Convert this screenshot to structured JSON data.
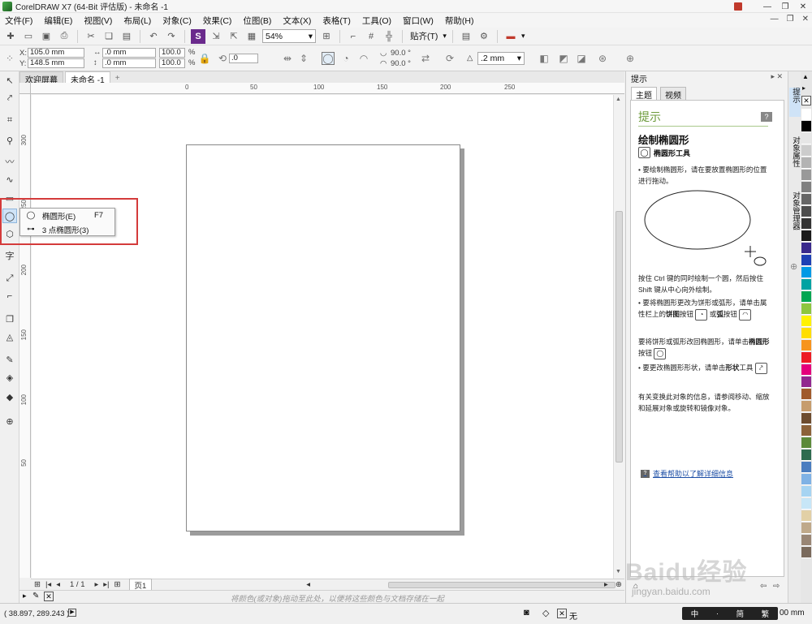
{
  "window": {
    "title": "CorelDRAW X7 (64-Bit 评估版) - 未命名 -1"
  },
  "menu": [
    "文件(F)",
    "编辑(E)",
    "视图(V)",
    "布局(L)",
    "对象(C)",
    "效果(C)",
    "位图(B)",
    "文本(X)",
    "表格(T)",
    "工具(O)",
    "窗口(W)",
    "帮助(H)"
  ],
  "toolbar": {
    "zoom": "54%",
    "snap_label": "贴齐(T)"
  },
  "property_bar": {
    "x": "105.0 mm",
    "y": "148.5 mm",
    "width": ".0 mm",
    "height": ".0 mm",
    "scale_x": "100.0",
    "scale_y": "100.0",
    "percent": "%",
    "rotation": ".0",
    "start_angle": "90.0 °",
    "end_angle": "90.0 °",
    "outline": ".2 mm",
    "label_x": "X:",
    "label_y": "Y:"
  },
  "doc_tabs": [
    "欢迎屏幕",
    "未命名 -1"
  ],
  "hruler": [
    "0",
    "50",
    "100",
    "150",
    "200",
    "250"
  ],
  "vruler": [
    "300",
    "250",
    "200",
    "150",
    "100",
    "50"
  ],
  "flyout": {
    "items": [
      {
        "label": "椭圆形(E)",
        "shortcut": "F7",
        "icon": "ellipse-icon"
      },
      {
        "label": "3 点椭圆形(3)",
        "shortcut": "",
        "icon": "three-point-ellipse-icon"
      }
    ]
  },
  "page_nav": {
    "counter": "1 / 1",
    "page_tab": "页1"
  },
  "color_hint": "将颜色(或对象)拖动至此处，以便将这些颜色与文档存储在一起",
  "status": {
    "coords": "( 38.897, 289.243 )",
    "fill_none": "无",
    "size": "00 mm"
  },
  "docker": {
    "title": "提示",
    "tabs": [
      "主题",
      "视频"
    ],
    "section_title": "提示",
    "heading": "绘制椭圆形",
    "tool_name": "椭圆形工具",
    "para1": "• 要绘制椭圆形，请在要放置椭圆形的位置进行拖动。",
    "para2": "按住 Ctrl 键的同时绘制一个圆，然后按住 Shift 键从中心向外绘制。",
    "para3a": "• 要将椭圆形更改为饼形或弧形，请单击属性栏上的",
    "para3_pie": "饼图",
    "para3b": "按钮",
    "para3c": "或",
    "para3_arc": "弧",
    "para3d": "按钮",
    "para4a": "要将饼形或弧形改回椭圆形，请单击",
    "para4_ellipse": "椭圆形",
    "para4b": "按钮",
    "para5a": "• 要更改椭圆形形状，请单击",
    "para5_shape": "形状",
    "para5b": "工具",
    "para6": "有关变换此对象的信息，请参阅移动、缩放和延展对象或旋转和镜像对象。",
    "more_link": "查看帮助以了解详细信息"
  },
  "side_tabs": [
    "提示",
    "对象属性",
    "对象管理器"
  ],
  "palette_colors": [
    "#ffffff",
    "#000000",
    "#e6e6e6",
    "#cccccc",
    "#b3b3b3",
    "#999999",
    "#808080",
    "#666666",
    "#4d4d4d",
    "#333333",
    "#1a1a1a",
    "#3a2a8c",
    "#1e40b4",
    "#0099e5",
    "#00a3a3",
    "#00a651",
    "#8dc63f",
    "#fff200",
    "#ffde00",
    "#f7941d",
    "#ed1c24",
    "#e4007c",
    "#92278f",
    "#a05a2c",
    "#c69c6d",
    "#6d4c2f",
    "#8c6239",
    "#5c8a3a",
    "#2e6b4f",
    "#4a7dbf",
    "#7fb2e5",
    "#a6d4f2",
    "#c7e6f7",
    "#e2d0a6",
    "#bfa98a",
    "#998675",
    "#7a6a5c"
  ],
  "watermark": "Baidu经验",
  "watermark_url": "jingyan.baidu.com",
  "ime": [
    "中",
    "·",
    "简",
    "繁"
  ]
}
